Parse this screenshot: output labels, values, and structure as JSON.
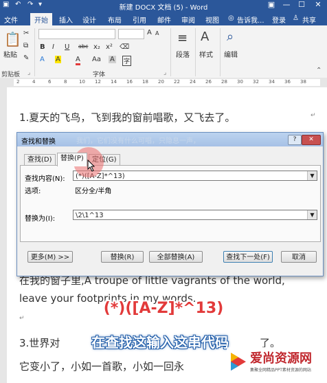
{
  "window": {
    "title": "新建 DOCX 文档 (5) - Word",
    "controls": [
      "▣",
      "—",
      "☐",
      "✕"
    ]
  },
  "tabs": {
    "items": [
      "文件",
      "开始",
      "插入",
      "设计",
      "布局",
      "引用",
      "邮件",
      "审阅",
      "视图"
    ],
    "active": "开始",
    "tell_me": "告诉我...",
    "login": "登录",
    "share": "共享"
  },
  "ribbon": {
    "paste_label": "粘贴",
    "clipboard_label": "剪贴板",
    "font_group_label": "字体",
    "paragraph_label": "段落",
    "styles_label": "样式",
    "editing_label": "编辑",
    "font_buttons": [
      "B",
      "I",
      "U",
      "abc",
      "x₂",
      "x²",
      "A",
      "A",
      "A",
      "Aa",
      "A"
    ]
  },
  "ruler": {
    "ticks": [
      "2",
      "4",
      "6",
      "8",
      "10",
      "12",
      "14",
      "16",
      "18",
      "20",
      "22",
      "24",
      "26",
      "28",
      "30",
      "32",
      "34",
      "36",
      "38"
    ]
  },
  "document": {
    "line1": "1.夏天的飞鸟，飞到我的窗前唱歌，又飞去了。",
    "line_behind_dialog": "在我的窗子里,A troupe of little vagrants of the world,",
    "line3": "leave your footprints in my words.",
    "line4": "3.世界对",
    "line4b": "了。",
    "line5": "它变小了，小如一首歌，小如一回永"
  },
  "dialog": {
    "title": "查找和替换",
    "title_faint": "我们，它们没有什么可唱，只隐息一声，",
    "tabs": [
      "查找(D)",
      "替换(P)",
      "定位(G)"
    ],
    "active_tab": "替换(P)",
    "find_label": "查找内容(N):",
    "find_value": "(*)([A-Z]*^13)",
    "options_label": "选项:",
    "options_value": "区分全/半角",
    "replace_label": "替换为(I):",
    "replace_value": "\\2\\1^13",
    "buttons": [
      "更多(M) >>",
      "替换(R)",
      "全部替换(A)",
      "查找下一处(F)",
      "取消"
    ],
    "help": "?",
    "close": "✕"
  },
  "overlay": {
    "code_caption": "(*)([A-Z]*^13)",
    "subtitle": "在查找这输入这串代码"
  },
  "watermark": {
    "name": "爱尚资源网",
    "tagline": "集聚全网精品PPT素材资源的网站"
  }
}
